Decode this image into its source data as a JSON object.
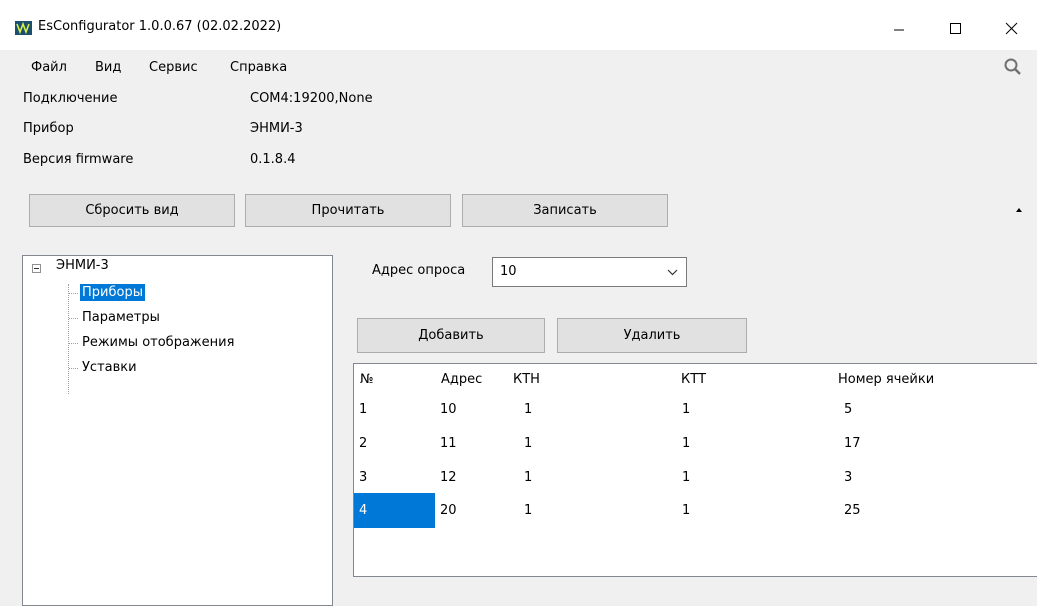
{
  "window": {
    "title": "EsConfigurator 1.0.0.67 (02.02.2022)"
  },
  "menu": [
    "Файл",
    "Вид",
    "Сервис",
    "Справка"
  ],
  "info": {
    "connection_label": "Подключение",
    "connection_value": "COM4:19200,None",
    "device_label": "Прибор",
    "device_value": "ЭНМИ-3",
    "firmware_label": "Версия firmware",
    "firmware_value": "0.1.8.4"
  },
  "toolbar": {
    "reset_label": "Сбросить вид",
    "read_label": "Прочитать",
    "write_label": "Записать"
  },
  "tree": {
    "root": "ЭНМИ-3",
    "children": [
      "Приборы",
      "Параметры",
      "Режимы отображения",
      "Уставки"
    ],
    "selected": "Приборы"
  },
  "poll": {
    "label": "Адрес опроса",
    "value": "10"
  },
  "actions": {
    "add_label": "Добавить",
    "delete_label": "Удалить"
  },
  "table": {
    "columns": [
      "№",
      "Адрес",
      "КТН",
      "КТТ",
      "Номер ячейки"
    ],
    "rows": [
      [
        "1",
        "10",
        "1",
        "1",
        "5"
      ],
      [
        "2",
        "11",
        "1",
        "1",
        "17"
      ],
      [
        "3",
        "12",
        "1",
        "1",
        "3"
      ],
      [
        "4",
        "20",
        "1",
        "1",
        "25"
      ]
    ],
    "selected_row": 4
  },
  "colors": {
    "selection": "#0078d7",
    "window_bg": "#f0f0f0",
    "titlebar_bg": "#ffffff"
  }
}
